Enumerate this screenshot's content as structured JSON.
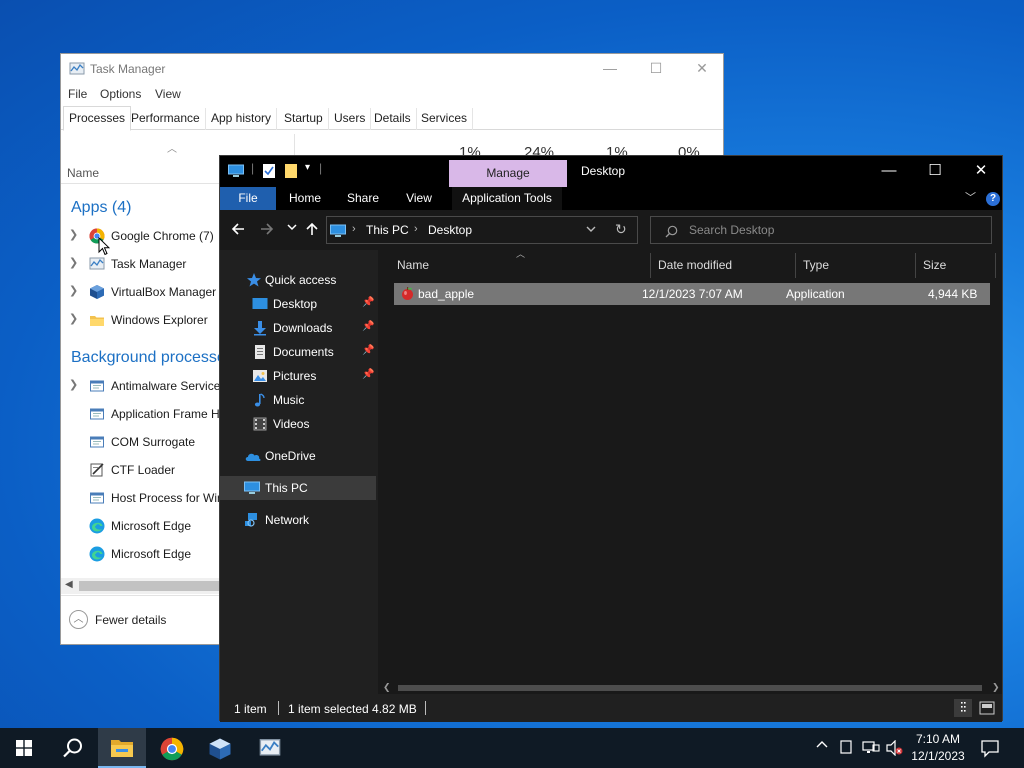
{
  "task_manager": {
    "title": "Task Manager",
    "window_controls": {
      "minimize": "—",
      "maximize": "☐",
      "close": "✕"
    },
    "menu": [
      "File",
      "Options",
      "View"
    ],
    "tabs": [
      "Processes",
      "Performance",
      "App history",
      "Startup",
      "Users",
      "Details",
      "Services"
    ],
    "active_tab": "Processes",
    "column_name": "Name",
    "usage_percents": [
      "1%",
      "24%",
      "1%",
      "0%"
    ],
    "apps_header": "Apps (4)",
    "apps": [
      {
        "label": "Google Chrome (7)",
        "icon": "chrome-icon"
      },
      {
        "label": "Task Manager",
        "icon": "task-manager-icon"
      },
      {
        "label": "VirtualBox Manager",
        "icon": "virtualbox-icon"
      },
      {
        "label": "Windows Explorer",
        "icon": "folder-icon"
      }
    ],
    "background_header": "Background processes",
    "background": [
      {
        "label": "Antimalware Service Executable",
        "icon": "service-icon",
        "expandable": true
      },
      {
        "label": "Application Frame Host",
        "icon": "service-icon",
        "expandable": false
      },
      {
        "label": "COM Surrogate",
        "icon": "service-icon",
        "expandable": false
      },
      {
        "label": "CTF Loader",
        "icon": "ctf-icon",
        "expandable": false
      },
      {
        "label": "Host Process for Windows Tasks",
        "icon": "service-icon",
        "expandable": false
      },
      {
        "label": "Microsoft Edge",
        "icon": "edge-icon",
        "expandable": false
      },
      {
        "label": "Microsoft Edge",
        "icon": "edge-icon",
        "expandable": false
      }
    ],
    "fewer_details": "Fewer details"
  },
  "explorer": {
    "title": "Desktop",
    "context_tab": "Manage",
    "ribbon_tabs": [
      "File",
      "Home",
      "Share",
      "View",
      "Application Tools"
    ],
    "window_controls": {
      "minimize": "—",
      "maximize": "☐",
      "close": "✕"
    },
    "help": "?",
    "address": {
      "segments": [
        "This PC",
        "Desktop"
      ]
    },
    "search_placeholder": "Search Desktop",
    "nav": {
      "quick_access": "Quick access",
      "pinned": [
        "Desktop",
        "Downloads",
        "Documents",
        "Pictures"
      ],
      "unpinned": [
        "Music",
        "Videos"
      ],
      "onedrive": "OneDrive",
      "this_pc": "This PC",
      "network": "Network"
    },
    "columns": [
      "Name",
      "Date modified",
      "Type",
      "Size"
    ],
    "files": [
      {
        "name": "bad_apple",
        "date_modified": "12/1/2023 7:07 AM",
        "type": "Application",
        "size": "4,944 KB",
        "selected": true
      }
    ],
    "status": {
      "count": "1 item",
      "selection": "1 item selected  4.82 MB"
    }
  },
  "taskbar": {
    "pinned": [
      "start-icon",
      "search-icon",
      "file-explorer-icon",
      "chrome-icon",
      "virtualbox-icon",
      "task-manager-icon"
    ],
    "active": "file-explorer-icon",
    "clock_time": "7:10 AM",
    "clock_date": "12/1/2023"
  },
  "colors": {
    "accent": "#1f5fae",
    "manage_tab": "#d9b8e8",
    "tm_group": "#1c70c4",
    "taskbar": "#0f1a25"
  }
}
